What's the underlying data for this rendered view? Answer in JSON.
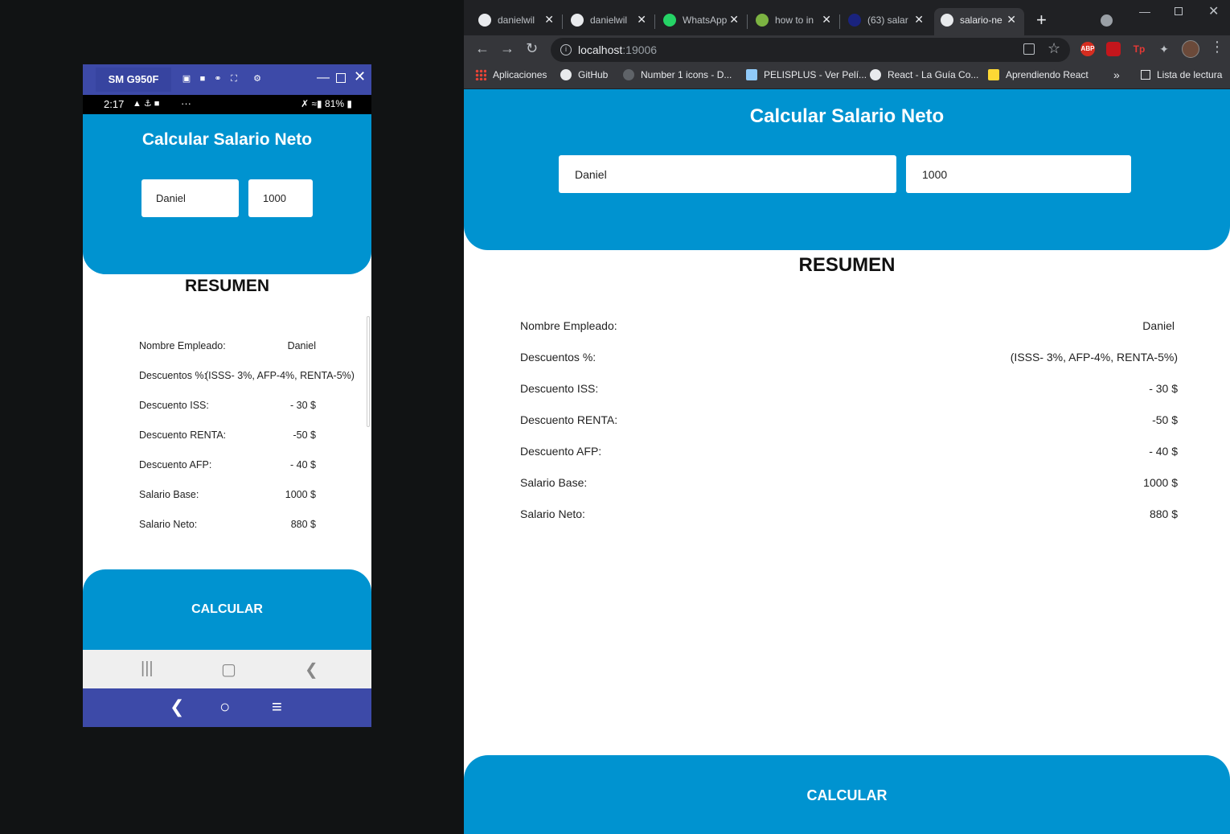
{
  "emulator": {
    "device": "SM G950F",
    "status": {
      "time": "2:17",
      "dots": "···",
      "battery": "81%"
    },
    "app": {
      "title": "Calcular Salario Neto",
      "name_value": "Daniel",
      "salary_value": "1000",
      "summary_title": "RESUMEN",
      "rows": [
        {
          "label": "Nombre Empleado:",
          "value": "Daniel"
        },
        {
          "label": "Descuentos %:",
          "value": "(ISSS- 3%, AFP-4%, RENTA-5%)"
        },
        {
          "label": "Descuento ISS:",
          "value": "- 30 $"
        },
        {
          "label": "Descuento RENTA:",
          "value": "-50 $"
        },
        {
          "label": "Descuento AFP:",
          "value": "- 40 $"
        },
        {
          "label": "Salario Base:",
          "value": "1000 $"
        },
        {
          "label": "Salario Neto:",
          "value": "880 $"
        }
      ],
      "calc_button": "CALCULAR"
    }
  },
  "browser": {
    "tabs": [
      {
        "title": "danielwil",
        "icon": "github-icon"
      },
      {
        "title": "danielwil",
        "icon": "github-icon"
      },
      {
        "title": "WhatsApp",
        "icon": "whatsapp-icon"
      },
      {
        "title": "how to in",
        "icon": "sparkle-icon"
      },
      {
        "title": "(63) salar",
        "icon": "page-icon"
      },
      {
        "title": "salario-ne",
        "icon": "app-icon",
        "active": true
      }
    ],
    "url_host": "localhost",
    "url_port": ":19006",
    "extensions": [
      {
        "label": "ABP",
        "color": "#d62d20"
      },
      {
        "label": "",
        "color": "#c4161c"
      },
      {
        "label": "Tp",
        "color": "#35363a"
      },
      {
        "label": "",
        "color": "#35363a"
      }
    ],
    "bookmarks": [
      {
        "label": "Aplicaciones"
      },
      {
        "label": "GitHub"
      },
      {
        "label": "Number 1 icons - D..."
      },
      {
        "label": "PELISPLUS - Ver Pelí..."
      },
      {
        "label": "React - La Guía Co..."
      },
      {
        "label": "Aprendiendo React"
      }
    ],
    "more": "»",
    "reading_list": "Lista de lectura"
  },
  "web": {
    "title": "Calcular Salario Neto",
    "name_value": "Daniel",
    "salary_value": "1000",
    "summary_title": "RESUMEN",
    "rows": [
      {
        "label": "Nombre Empleado:",
        "value": "Daniel"
      },
      {
        "label": "Descuentos %:",
        "value": "(ISSS- 3%, AFP-4%, RENTA-5%)"
      },
      {
        "label": "Descuento ISS:",
        "value": "- 30 $"
      },
      {
        "label": "Descuento RENTA:",
        "value": "-50 $"
      },
      {
        "label": "Descuento AFP:",
        "value": "- 40 $"
      },
      {
        "label": "Salario Base:",
        "value": "1000 $"
      },
      {
        "label": "Salario Neto:",
        "value": "880 $"
      }
    ],
    "calc_button": "CALCULAR"
  },
  "colors": {
    "primary": "#0093d0",
    "emulator_bar": "#3d4aa8",
    "chrome_dark": "#202124",
    "chrome_toolbar": "#35363a"
  }
}
